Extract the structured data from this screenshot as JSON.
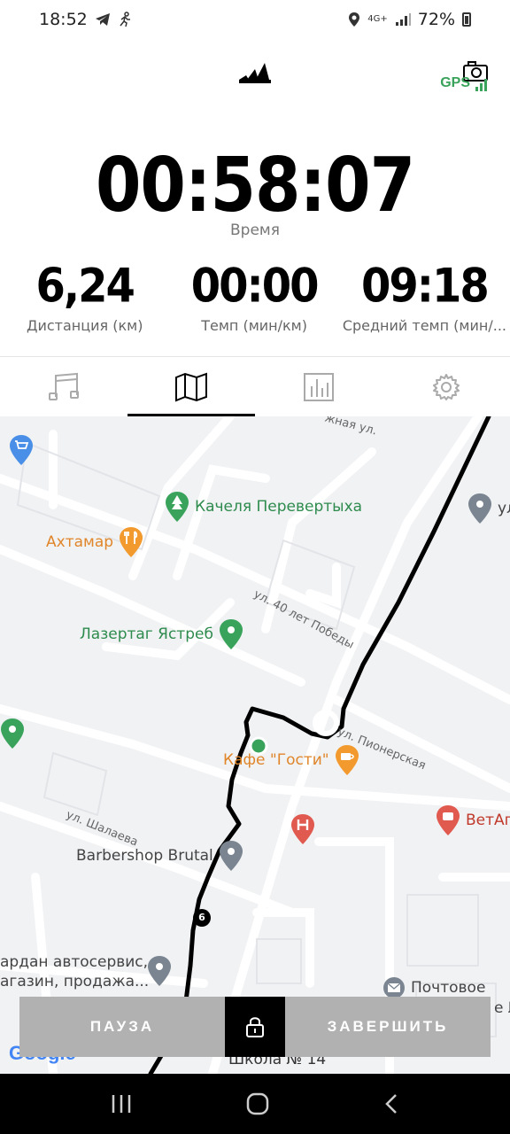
{
  "status_bar": {
    "time": "18:52",
    "network": "4G+",
    "battery": "72%"
  },
  "header": {
    "logo_icon": "adidas-logo-icon",
    "camera_icon": "camera-icon",
    "gps_label": "GPS"
  },
  "workout": {
    "duration": "00:58:07",
    "duration_label": "Время",
    "stats": [
      {
        "value": "6,24",
        "label": "Дистанция (км)"
      },
      {
        "value": "00:00",
        "label": "Темп (мин/км)"
      },
      {
        "value": "09:18",
        "label": "Средний темп (мин/..."
      }
    ]
  },
  "tabs": [
    {
      "name": "music",
      "icon": "music-note-icon"
    },
    {
      "name": "map",
      "icon": "map-icon",
      "active": true
    },
    {
      "name": "stats",
      "icon": "bar-chart-icon"
    },
    {
      "name": "settings",
      "icon": "gear-icon"
    }
  ],
  "map": {
    "pois": [
      {
        "name": "Качеля Перевертыха",
        "type": "park"
      },
      {
        "name": "Ахтамар",
        "type": "restaurant"
      },
      {
        "name": "Лазертаг Ястреб",
        "type": "park"
      },
      {
        "name": "Кафе \"Гости\"",
        "type": "cafe"
      },
      {
        "name": "Barbershop Brutal",
        "type": "place"
      },
      {
        "name": "ВетАп",
        "type": "pharmacy"
      },
      {
        "name": "ардан автосервис,",
        "type": "place"
      },
      {
        "name": "агазин, продажа...",
        "type": "place"
      },
      {
        "name": "Почтовое",
        "type": "post"
      },
      {
        "name": "ул",
        "type": "place"
      }
    ],
    "streets": [
      "ул. 40 лет Победы",
      "ул. Пионерская",
      "ул. Шалаева",
      "жная ул."
    ],
    "marker_km": "6",
    "school_label": "Школа № 14",
    "attribution": "Google",
    "corner_text": "е №"
  },
  "controls": {
    "pause_label": "ПАУЗА",
    "finish_label": "ЗАВЕРШИТЬ",
    "lock_icon": "lock-icon"
  },
  "colors": {
    "accent_gps": "#3aa35b",
    "route": "#000000",
    "button_grey": "#b1b1b1"
  }
}
